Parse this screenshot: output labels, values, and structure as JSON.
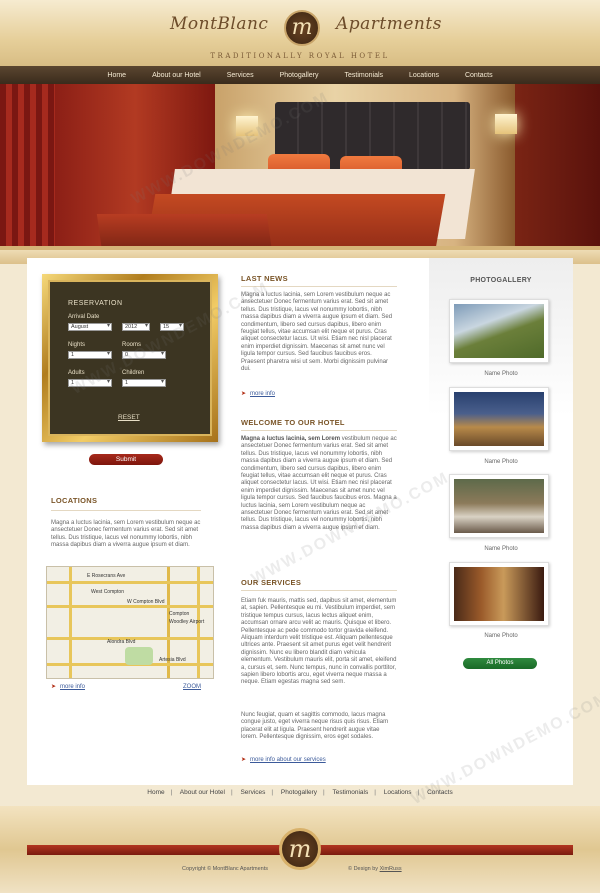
{
  "brand": {
    "left": "MontBlanc",
    "logo_letter": "m",
    "right": "Apartments",
    "tagline": "TRADITIONALLY ROYAL HOTEL"
  },
  "nav": [
    "Home",
    "About our Hotel",
    "Services",
    "Photogallery",
    "Testimonials",
    "Locations",
    "Contacts"
  ],
  "reservation": {
    "title": "RESERVATION",
    "arrival_label": "Arrival Date",
    "arrival_month": "August",
    "arrival_year": "2012",
    "arrival_day": "15",
    "nights_label": "Nights",
    "nights_value": "1",
    "rooms_label": "Rooms",
    "rooms_value": "0",
    "adults_label": "Adults",
    "adults_value": "1",
    "children_label": "Children",
    "children_value": "1",
    "reset": "RESET",
    "submit": "Submit"
  },
  "locations": {
    "heading": "LOCATIONS",
    "text": "Magna a luctus lacinia, sem Lorem vestibulum neque ac ansectetuer Donec fermentum varius erat. Sed sit amet tellus. Dus tristique, lacus vel nonummy lobortis, nibh massa dapibus diam a viverra augue ipsum et diam.",
    "map_labels": [
      "E Rosecrans Ave",
      "West Compton",
      "W Compton Blvd",
      "Compton",
      "Woodley Airport",
      "Alondra Blvd",
      "Artesia Blvd"
    ],
    "more_info": "more info",
    "zoom": "ZOOM"
  },
  "news": {
    "heading": "LAST NEWS",
    "text": "Magna a luctus lacinia, sem Lorem vestibulum neque ac ansectetuer Donec fermentum varius erat. Sed sit amet tellus. Dus tristique, lacus vel nonummy lobortis, nibh massa dapibus diam a viverra augue ipsum et diam. Sed condimentum, libero sed cursus dapibus, libero enim feugiat tellus, vitae accumsan elit neque et purus. Cras aliquet consectetur lacus. Ut wisi. Etiam nec nisl placerat enim imperdiet dignissim. Maecenas sit amet nunc vel ligula tempor cursus. Sed faucibus faucibus eros. Praesent pharetra wisi ut sem. Morbi dignissim pulvinar dui.",
    "more_info": "more info"
  },
  "welcome": {
    "heading": "WELCOME TO OUR HOTEL",
    "lead": "Magna a luctus lacinia, sem Lorem",
    "text": " vestibulum neque ac ansectetuer Donec fermentum varius erat. Sed sit amet tellus. Dus tristique, lacus vel nonummy lobortis, nibh massa dapibus diam a viverra augue ipsum et diam. Sed condimentum, libero sed cursus dapibus, libero enim feugiat tellus, vitae accumsan elit neque et purus. Cras aliquet consectetur lacus. Ut wisi. Etiam nec nisl placerat enim imperdiet dignissim. Maecenas sit amet nunc vel ligula tempor cursus. Sed faucibus faucibus eros. Magna a luctus lacinia, sem Lorem vestibulum neque ac ansectetuer Donec fermentum varius erat. Sed sit amet tellus. Dus tristique, lacus vel nonummy lobortis, nibh massa dapibus diam a viverra augue ipsum et diam."
  },
  "services": {
    "heading": "OUR SERVICES",
    "text1": "Etiam fuk mauris, mattis sed, dapibus sit amet, elementum at, sapien. Pellentesque eu mi. Vestibulum imperdiet, sem tristique tempus cursus, lacus lectus aliquet enim, accumsan ornare arcu velit ac mauris. Quisque et libero. Pellentesque ac pede commodo tortor gravida eleifend. Aliquam interdum velit tristique est. Aliquam pellentesque ultrices ante. Praesent sit amet purus eget velit hendrerit dignissim. Nunc eu libero blandit diam vehicula elementum. Vestibulum mauris elit, porta sit amet, eleifend a, cursus et, sem. Nunc tempus, nunc in convallis porttitor, sapien libero lobortis arcu, eget viverra neque massa a neque. Etiam egestas magna sed sem.",
    "text2": "Nunc feugiat, quam et sagittis commodo, lacus magna congue justo, eget viverra neque risus quis risus. Etiam placerat elit at ligula. Praesent hendrerit augue vitae lorem. Pellentesque dignissim, eros eget sodales.",
    "more_info": "more info about our services"
  },
  "photogallery": {
    "heading": "PHOTOGALLERY",
    "items": [
      "Name Photo",
      "Name Photo",
      "Name Photo",
      "Name Photo"
    ],
    "all_photos": "All Photos"
  },
  "footer": {
    "nav": [
      "Home",
      "About our Hotel",
      "Services",
      "Photogallery",
      "Testimonials",
      "Locations",
      "Contacts"
    ],
    "copyright": "Copyright © MontBlanc Apartments",
    "design_prefix": "© Design by ",
    "design_link": "XimRuss"
  },
  "watermark": "WWW.DOWNDEMO.COM"
}
